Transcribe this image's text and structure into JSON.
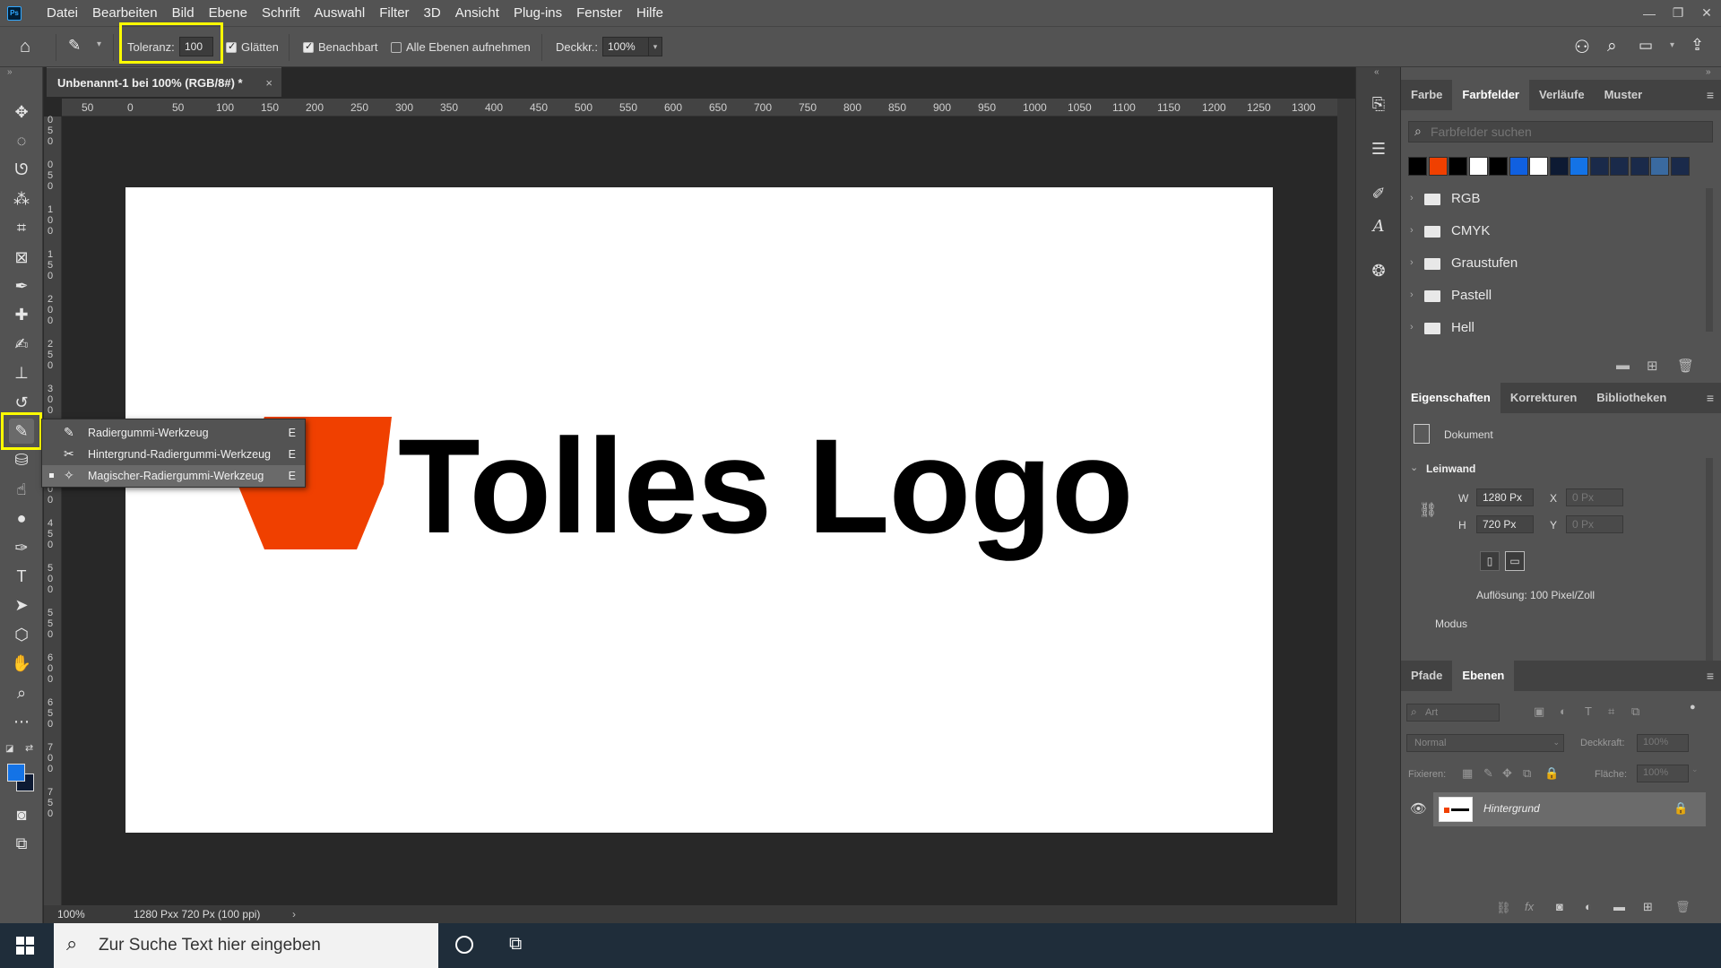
{
  "menubar": {
    "app_icon": "photoshop-logo",
    "app_icon_text": "Ps",
    "items": [
      "Datei",
      "Bearbeiten",
      "Bild",
      "Ebene",
      "Schrift",
      "Auswahl",
      "Filter",
      "3D",
      "Ansicht",
      "Plug-ins",
      "Fenster",
      "Hilfe"
    ],
    "window_controls": [
      "minimize-icon",
      "restore-icon",
      "close-icon"
    ]
  },
  "options": {
    "tolerance_label": "Toleranz:",
    "tolerance_value": "100",
    "smooth_label": "Glätten",
    "smooth_checked": true,
    "contiguous_label": "Benachbart",
    "contiguous_checked": true,
    "all_layers_label": "Alle Ebenen aufnehmen",
    "all_layers_checked": false,
    "opacity_label": "Deckkr.:",
    "opacity_value": "100%"
  },
  "document": {
    "tab_title": "Unbenannt-1 bei 100% (RGB/8#) *",
    "zoom": "100%",
    "status_info": "1280 Pxx 720 Px (100 ppi)",
    "logo_text": "Tolles Logo",
    "logo_color": "#f04000",
    "ruler_h": [
      "50",
      "0",
      "50",
      "100",
      "150",
      "200",
      "250",
      "300",
      "350",
      "400",
      "450",
      "500",
      "550",
      "600",
      "650",
      "700",
      "750",
      "800",
      "850",
      "900",
      "950",
      "1000",
      "1050",
      "1100",
      "1150",
      "1200",
      "1250",
      "1300"
    ],
    "ruler_v": [
      "0",
      "5",
      "0",
      "0",
      "5",
      "0",
      "1",
      "0",
      "0",
      "1",
      "5",
      "0",
      "2",
      "0",
      "0",
      "2",
      "5",
      "0",
      "3",
      "0",
      "0",
      "3",
      "5",
      "0",
      "4",
      "0",
      "0",
      "4",
      "5",
      "0",
      "5",
      "0",
      "0",
      "5",
      "5",
      "0",
      "6",
      "0",
      "0",
      "6",
      "5",
      "0",
      "7",
      "0",
      "0",
      "7",
      "5",
      "0"
    ]
  },
  "flyout": {
    "items": [
      {
        "label": "Radiergummi-Werkzeug",
        "shortcut": "E"
      },
      {
        "label": "Hintergrund-Radiergummi-Werkzeug",
        "shortcut": "E"
      },
      {
        "label": "Magischer-Radiergummi-Werkzeug",
        "shortcut": "E"
      }
    ]
  },
  "swatches_panel": {
    "tabs": [
      "Farbe",
      "Farbfelder",
      "Verläufe",
      "Muster"
    ],
    "active_tab": "Farbfelder",
    "search_placeholder": "Farbfelder suchen",
    "swatch_colors": [
      "#000000",
      "#f04000",
      "#000000",
      "#ffffff",
      "#000000",
      "#1060e0",
      "#ffffff",
      "#0d1a33",
      "#1473e6",
      "#1a2a4a",
      "#1a2a4a",
      "#1a2a4a",
      "#3a6aa0",
      "#1a2a4a"
    ],
    "folders": [
      "RGB",
      "CMYK",
      "Graustufen",
      "Pastell",
      "Hell"
    ]
  },
  "properties_panel": {
    "tabs": [
      "Eigenschaften",
      "Korrekturen",
      "Bibliotheken"
    ],
    "active_tab": "Eigenschaften",
    "doc_label": "Dokument",
    "section_label": "Leinwand",
    "w_label": "W",
    "w_value": "1280 Px",
    "h_label": "H",
    "h_value": "720 Px",
    "x_label": "X",
    "x_value": "0 Px",
    "y_label": "Y",
    "y_value": "0 Px",
    "resolution": "Auflösung: 100 Pixel/Zoll",
    "mode_label": "Modus"
  },
  "layers_panel": {
    "tabs": [
      "Pfade",
      "Ebenen"
    ],
    "active_tab": "Ebenen",
    "filter_placeholder": "Art",
    "blend_mode": "Normal",
    "opacity_label": "Deckkraft:",
    "opacity_value": "100%",
    "lock_label": "Fixieren:",
    "fill_label": "Fläche:",
    "fill_value": "100%",
    "layer_name": "Hintergrund"
  },
  "taskbar": {
    "search_placeholder": "Zur Suche Text hier eingeben"
  }
}
